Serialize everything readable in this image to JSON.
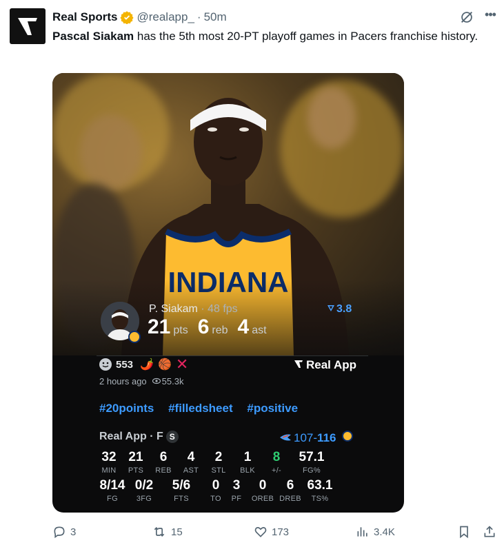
{
  "tweet": {
    "author_name": "Real Sports",
    "handle": "@realapp_",
    "dot": "·",
    "time": "50m",
    "text_bold": "Pascal Siakam",
    "text_rest": " has the 5th most 20-PT playoff games in Pacers franchise history."
  },
  "card": {
    "player": {
      "name": "P. Siakam",
      "sep": " · ",
      "fps": "48 fps",
      "rating": "3.8",
      "stats": [
        {
          "value": "21",
          "unit": "pts"
        },
        {
          "value": "6",
          "unit": "reb"
        },
        {
          "value": "4",
          "unit": "ast"
        }
      ]
    },
    "jersey_text": "INDIANA",
    "reactions": {
      "count": "553",
      "emojis": [
        "🌶️",
        "🏀"
      ],
      "x": "✕"
    },
    "brand": "Real App",
    "meta": {
      "time": "2 hours ago",
      "views": "55.3k"
    },
    "hashtags": [
      "#20points",
      "#filledsheet",
      "#positive"
    ],
    "statsheet": {
      "title": "Real App · F",
      "badge": "S",
      "away_score": "107",
      "dash": "-",
      "home_score": "116",
      "row1": [
        {
          "value": "32",
          "label": "MIN"
        },
        {
          "value": "21",
          "label": "PTS"
        },
        {
          "value": "6",
          "label": "REB"
        },
        {
          "value": "4",
          "label": "AST"
        },
        {
          "value": "2",
          "label": "STL"
        },
        {
          "value": "1",
          "label": "BLK"
        },
        {
          "value": "8",
          "label": "+/-"
        },
        {
          "value": "57.1",
          "label": "FG%"
        }
      ],
      "row2": [
        {
          "value": "8/14",
          "label": "FG"
        },
        {
          "value": "0/2",
          "label": "3FG"
        },
        {
          "value": "5/6",
          "label": "FTS"
        },
        {
          "value": "0",
          "label": "TO"
        },
        {
          "value": "3",
          "label": "PF"
        },
        {
          "value": "0",
          "label": "OREB"
        },
        {
          "value": "6",
          "label": "DREB"
        },
        {
          "value": "63.1",
          "label": "TS%"
        }
      ]
    }
  },
  "actions": {
    "replies": "3",
    "reposts": "15",
    "likes": "173",
    "views": "3.4K"
  },
  "colors": {
    "accent_blue": "#3d9bff",
    "verified_gold": "#f4b400",
    "plusminus_green": "#2ecc71",
    "pacers_yellow": "#fdbb30",
    "pacers_navy": "#0b2d6b"
  },
  "icons": [
    "real-app-logo-icon",
    "verified-badge-icon",
    "grok-icon",
    "more-icon",
    "reply-icon",
    "repost-icon",
    "like-icon",
    "views-icon",
    "bookmark-icon",
    "share-icon"
  ]
}
